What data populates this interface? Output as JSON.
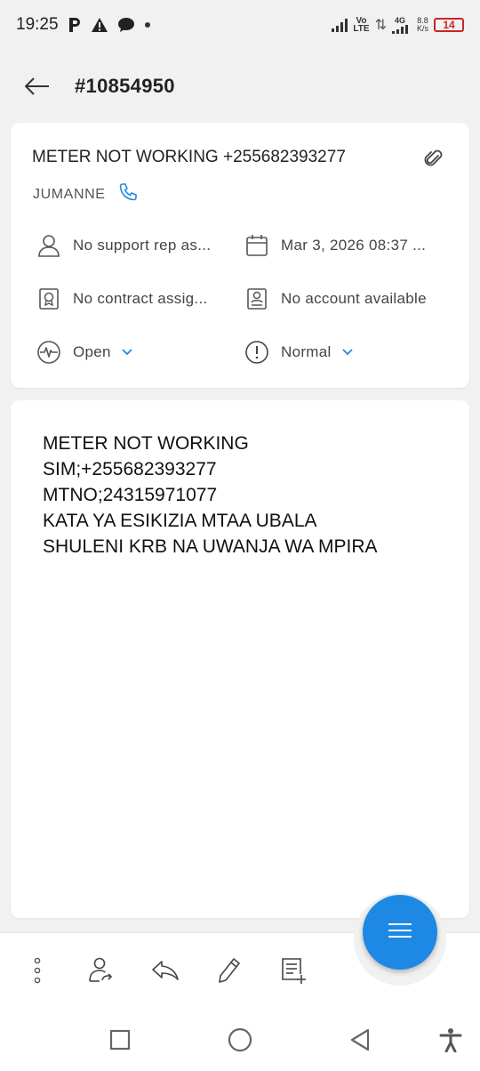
{
  "status_bar": {
    "time": "19:25",
    "network_top": "Vo",
    "network_bottom": "LTE",
    "gen": "4G",
    "speed_top": "8.8",
    "speed_bottom": "K/s",
    "battery": "14"
  },
  "header": {
    "title": "#10854950"
  },
  "ticket": {
    "subject": "METER NOT WORKING +255682393277",
    "contact_name": "JUMANNE",
    "support_rep": "No support rep as...",
    "date": "Mar 3, 2026 08:37 ...",
    "contract": "No contract assig...",
    "account": "No account available",
    "status": "Open",
    "priority": "Normal"
  },
  "message": {
    "text": "METER NOT WORKING\nSIM;+255682393277\nMTNO;24315971077\nKATA YA ESIKIZIA MTAA UBALA\nSHULENI  KRB NA UWANJA WA MPIRA"
  },
  "colors": {
    "accent": "#1e88e5",
    "battery": "#c62828"
  },
  "icons": {
    "toolbar": [
      "more-options-icon",
      "assign-user-icon",
      "reply-icon",
      "edit-pencil-icon",
      "add-note-icon"
    ],
    "fab": "menu-lines-icon",
    "nav": [
      "recents-square-icon",
      "home-circle-icon",
      "back-triangle-icon",
      "accessibility-icon"
    ]
  }
}
